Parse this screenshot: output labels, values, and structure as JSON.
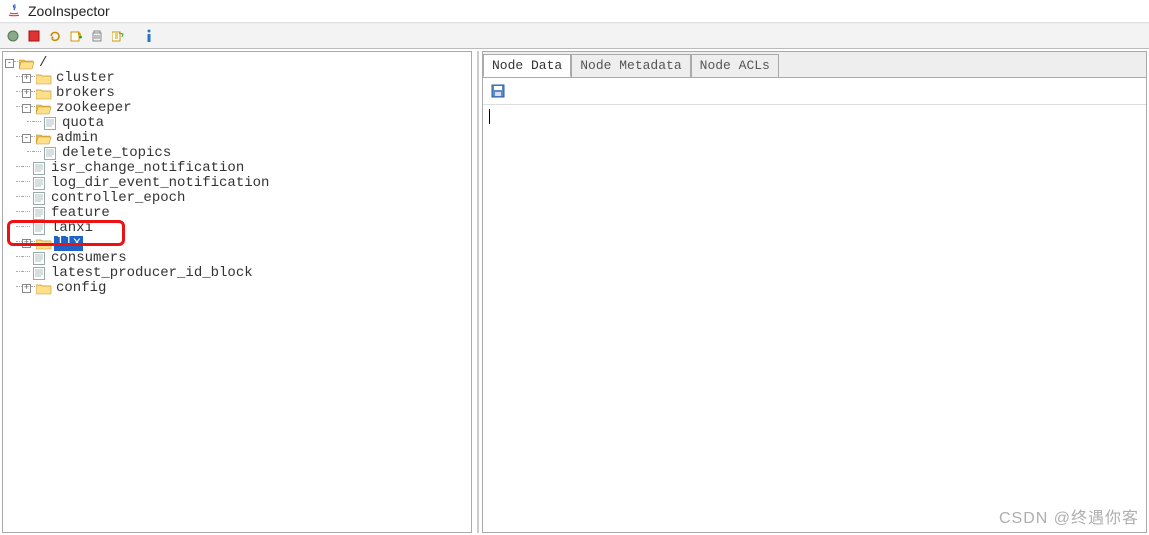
{
  "title": "ZooInspector",
  "watermark": "CSDN @终遇你客",
  "toolbar_icons": [
    "connect",
    "disconnect",
    "refresh",
    "add",
    "delete",
    "edit",
    "info"
  ],
  "tabs": [
    {
      "id": "node-data",
      "label": "Node Data",
      "active": true
    },
    {
      "id": "node-metadata",
      "label": "Node Metadata",
      "active": false
    },
    {
      "id": "node-acls",
      "label": "Node ACLs",
      "active": false
    }
  ],
  "content_value": "",
  "selected_node": "llx",
  "highlighted_node": "lanxi",
  "tree": [
    {
      "depth": 0,
      "toggle": "-",
      "icon": "folder-open",
      "label": "/",
      "indent": 0
    },
    {
      "depth": 1,
      "toggle": "+",
      "icon": "folder-closed",
      "label": "cluster",
      "indent": 1
    },
    {
      "depth": 1,
      "toggle": "+",
      "icon": "folder-closed",
      "label": "brokers",
      "indent": 1
    },
    {
      "depth": 1,
      "toggle": "-",
      "icon": "folder-open",
      "label": "zookeeper",
      "indent": 1
    },
    {
      "depth": 2,
      "toggle": "",
      "icon": "file",
      "label": "quota",
      "indent": 2,
      "last": true
    },
    {
      "depth": 1,
      "toggle": "-",
      "icon": "folder-open",
      "label": "admin",
      "indent": 1
    },
    {
      "depth": 2,
      "toggle": "",
      "icon": "file",
      "label": "delete_topics",
      "indent": 2,
      "last": true
    },
    {
      "depth": 1,
      "toggle": "",
      "icon": "file",
      "label": "isr_change_notification",
      "indent": 1
    },
    {
      "depth": 1,
      "toggle": "",
      "icon": "file",
      "label": "log_dir_event_notification",
      "indent": 1
    },
    {
      "depth": 1,
      "toggle": "",
      "icon": "file",
      "label": "controller_epoch",
      "indent": 1
    },
    {
      "depth": 1,
      "toggle": "",
      "icon": "file",
      "label": "feature",
      "indent": 1
    },
    {
      "depth": 1,
      "toggle": "",
      "icon": "file",
      "label": "lanxi",
      "indent": 1,
      "highlight": true
    },
    {
      "depth": 1,
      "toggle": "+",
      "icon": "folder-closed",
      "label": "llx",
      "indent": 1,
      "selected": true
    },
    {
      "depth": 1,
      "toggle": "",
      "icon": "file",
      "label": "consumers",
      "indent": 1
    },
    {
      "depth": 1,
      "toggle": "",
      "icon": "file",
      "label": "latest_producer_id_block",
      "indent": 1
    },
    {
      "depth": 1,
      "toggle": "+",
      "icon": "folder-closed",
      "label": "config",
      "indent": 1,
      "last": true
    }
  ]
}
